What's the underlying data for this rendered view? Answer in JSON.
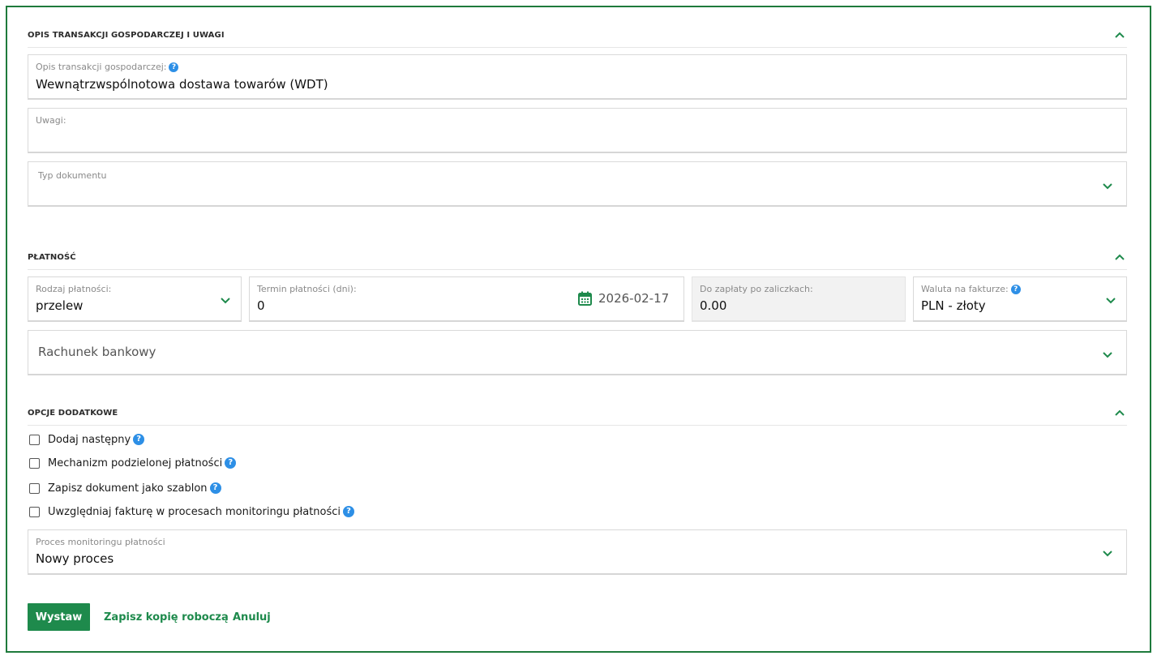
{
  "colors": {
    "accent": "#1e8a4c",
    "frame_border": "#1e7a3c",
    "help_icon": "#2d8fe6",
    "disabled_bg": "#f2f2f2"
  },
  "sections": {
    "description": {
      "title": "OPIS TRANSAKCJI GOSPODARCZEJ I UWAGI",
      "toggle_icon": "chevron-up-icon"
    },
    "payment": {
      "title": "PŁATNOŚĆ",
      "toggle_icon": "chevron-up-icon"
    },
    "options": {
      "title": "OPCJE DODATKOWE",
      "toggle_icon": "chevron-up-icon"
    }
  },
  "description": {
    "transaction": {
      "label": "Opis transakcji gospodarczej:",
      "help_icon": "help-icon",
      "value": "Wewnątrzwspólnotowa dostawa towarów  (WDT)"
    },
    "notes": {
      "label": "Uwagi:",
      "value": ""
    },
    "doc_type": {
      "label": "Typ dokumentu",
      "value": ""
    }
  },
  "payment": {
    "method": {
      "label": "Rodzaj płatności:",
      "value": "przelew"
    },
    "term": {
      "label": "Termin płatności (dni):",
      "value": "0",
      "date": "2026-02-17",
      "calendar_icon": "calendar-icon"
    },
    "due": {
      "label": "Do zapłaty po zaliczkach:",
      "value": "0.00"
    },
    "currency": {
      "label": "Waluta na fakturze:",
      "value": "PLN - złoty"
    },
    "bank_account": {
      "placeholder": "Rachunek bankowy"
    }
  },
  "options": {
    "checkboxes": [
      {
        "label": "Dodaj następny",
        "checked": false
      },
      {
        "label": "Mechanizm podzielonej płatności",
        "checked": false
      },
      {
        "label": "Zapisz dokument jako szablon",
        "checked": false
      },
      {
        "label": "Uwzględniaj fakturę w procesach monitoringu płatności",
        "checked": false
      }
    ],
    "monitoring_process": {
      "label": "Proces monitoringu płatności",
      "value": "Nowy proces"
    }
  },
  "actions": {
    "submit": "Wystaw",
    "save_draft": "Zapisz kopię roboczą",
    "cancel": "Anuluj"
  }
}
